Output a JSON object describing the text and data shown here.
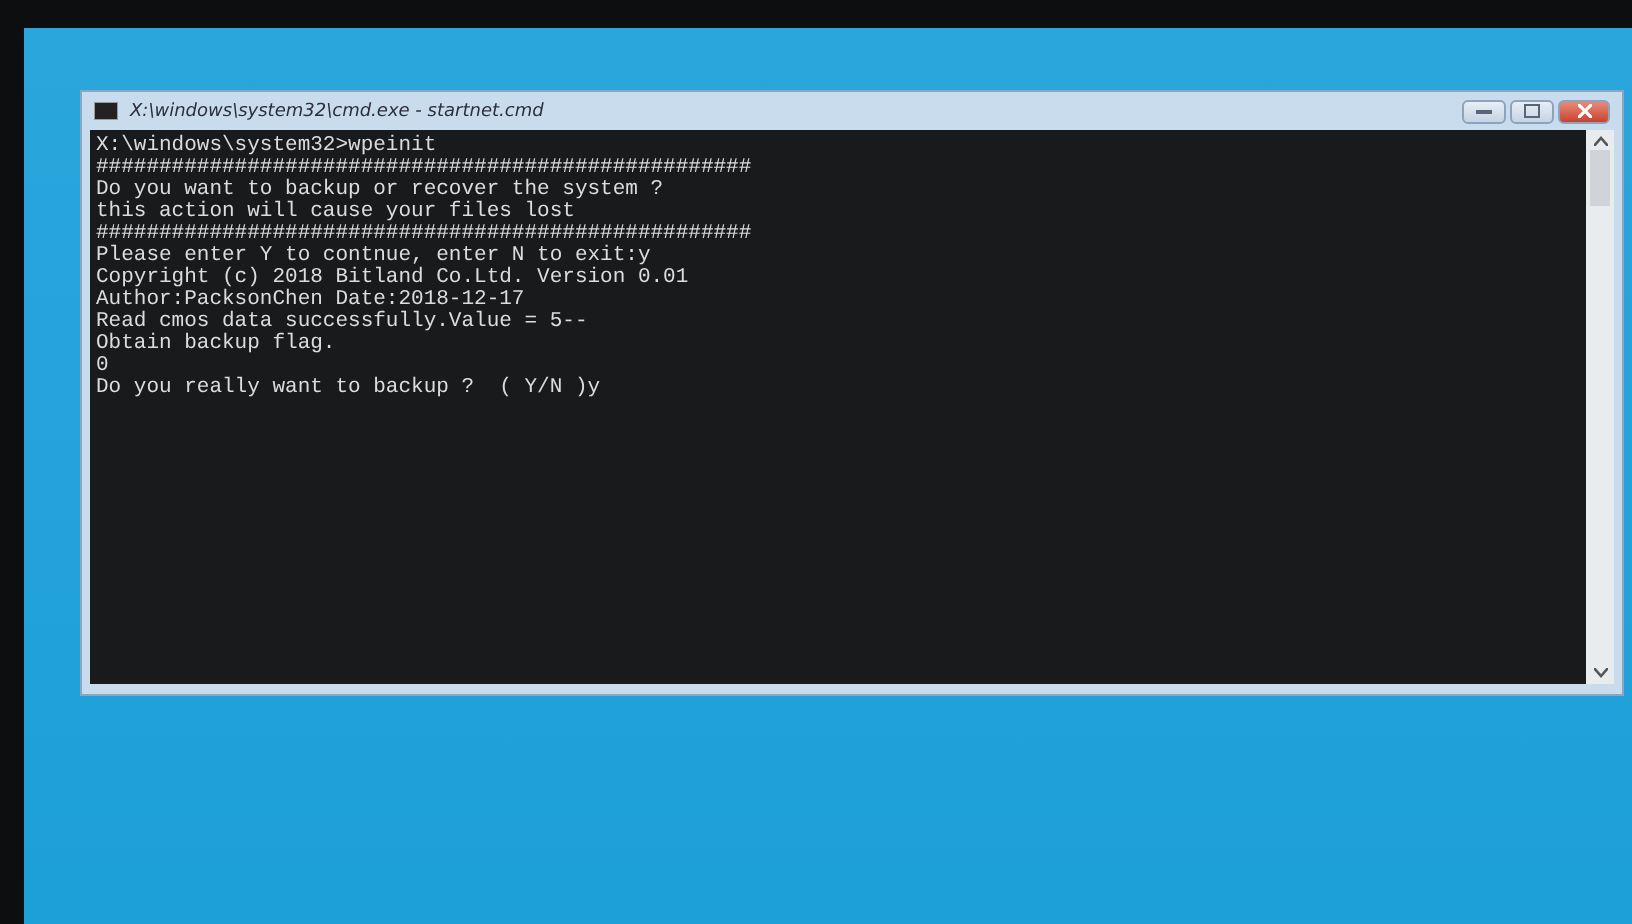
{
  "window": {
    "title": "X:\\windows\\system32\\cmd.exe - startnet.cmd"
  },
  "console": {
    "lines": [
      "X:\\windows\\system32>wpeinit",
      "####################################################",
      "Do you want to backup or recover the system ?",
      "this action will cause your files lost",
      "####################################################",
      "Please enter Y to contnue, enter N to exit:y",
      "Copyright (c) 2018 Bitland Co.Ltd. Version 0.01",
      "Author:PacksonChen Date:2018-12-17",
      "Read cmos data successfully.Value = 5--",
      "Obtain backup flag.",
      "0",
      "Do you really want to backup ?  ( Y/N )y"
    ]
  }
}
